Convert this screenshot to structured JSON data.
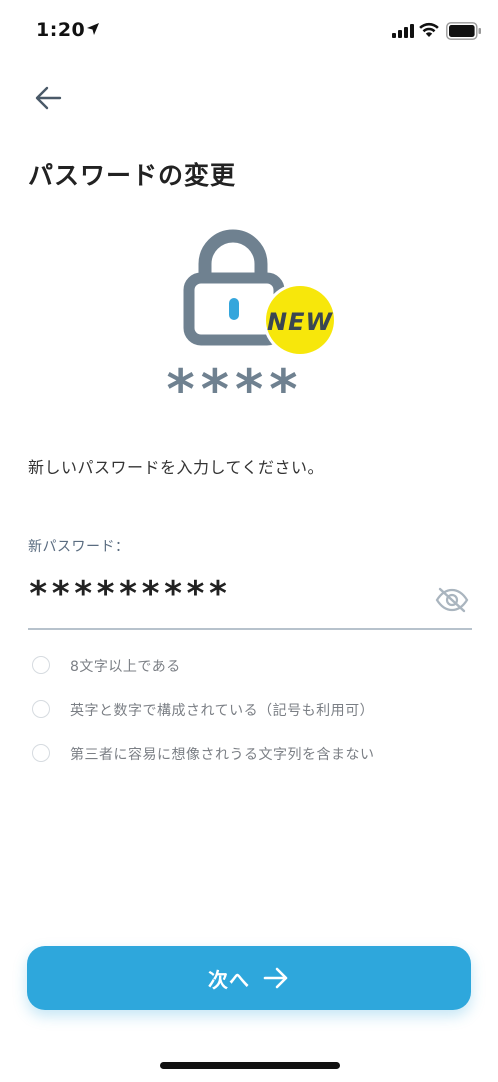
{
  "status_bar": {
    "time": "1:20",
    "icons": [
      "location-arrow-icon",
      "cellular-signal-icon",
      "wifi-icon",
      "battery-icon"
    ]
  },
  "header": {
    "back_icon": "arrow-left-icon",
    "title": "パスワードの変更"
  },
  "illustration": {
    "badge": "NEW",
    "mask": "****",
    "colors": {
      "lock": "#6f8190",
      "keyhole": "#35a6dc",
      "badge": "#f7e70b"
    }
  },
  "instruction": "新しいパスワードを入力してください。",
  "password": {
    "label": "新パスワード：",
    "value": "*********",
    "toggle_icon": "eye-slash-icon"
  },
  "rules": [
    {
      "text": "8文字以上である",
      "checked": false
    },
    {
      "text": "英字と数字で構成されている（記号も利用可）",
      "checked": false
    },
    {
      "text": "第三者に容易に想像されうる文字列を含まない",
      "checked": false
    }
  ],
  "next_button": {
    "label": "次へ",
    "icon": "arrow-right-icon",
    "color": "#2ea7dc"
  }
}
